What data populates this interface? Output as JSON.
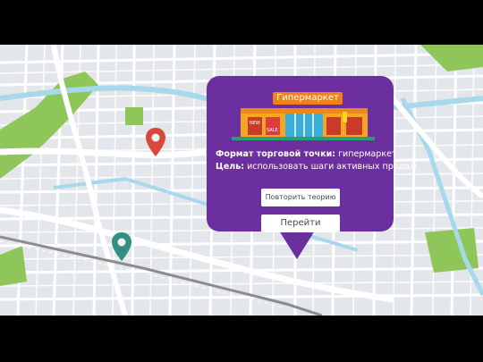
{
  "popup": {
    "store_sign": "Гипермаркет",
    "store_tags": {
      "new": "NEW",
      "sale": "SALE"
    },
    "format_label": "Формат торговой точки:",
    "format_value": "гипермаркет",
    "goal_label": "Цель:",
    "goal_value": "использовать шаги активных продаж",
    "repeat_button": "Повторить теорию",
    "go_button": "Перейти"
  },
  "map": {
    "pins": [
      {
        "name": "red-location-pin",
        "color": "#d9493a"
      },
      {
        "name": "teal-location-pin",
        "color": "#2f8f82"
      }
    ],
    "colors": {
      "road": "#ffffff",
      "block": "#dfe2e6",
      "water": "#a8d8ec",
      "park": "#8fc65a",
      "rail": "#8c8c8c"
    }
  }
}
